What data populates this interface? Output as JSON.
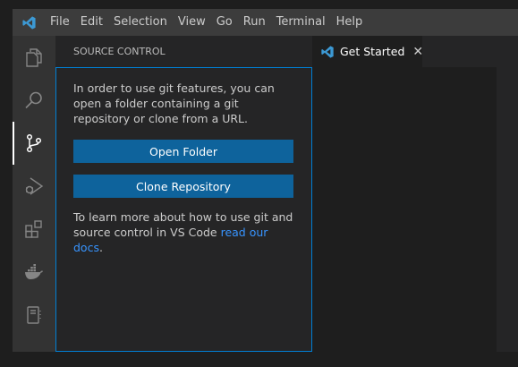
{
  "menu": [
    "File",
    "Edit",
    "Selection",
    "View",
    "Go",
    "Run",
    "Terminal",
    "Help"
  ],
  "activity_icons": [
    "explorer-icon",
    "search-icon",
    "source-control-icon",
    "run-debug-icon",
    "extensions-icon",
    "docker-icon",
    "notebook-icon"
  ],
  "sidebar": {
    "title": "SOURCE CONTROL",
    "intro": "In order to use git features, you can open a folder containing a git repository or clone from a URL.",
    "open_folder": "Open Folder",
    "clone_repository": "Clone Repository",
    "learn_text": "To learn more about how to use git and source control in VS Code ",
    "learn_link": "read our docs",
    "learn_end": "."
  },
  "tabs": [
    {
      "label": "Get Started",
      "close": "✕"
    }
  ],
  "colors": {
    "accent": "#007fd4",
    "button": "#0e639c",
    "link": "#3794ff",
    "vscode_blue": "#3c99d4"
  }
}
